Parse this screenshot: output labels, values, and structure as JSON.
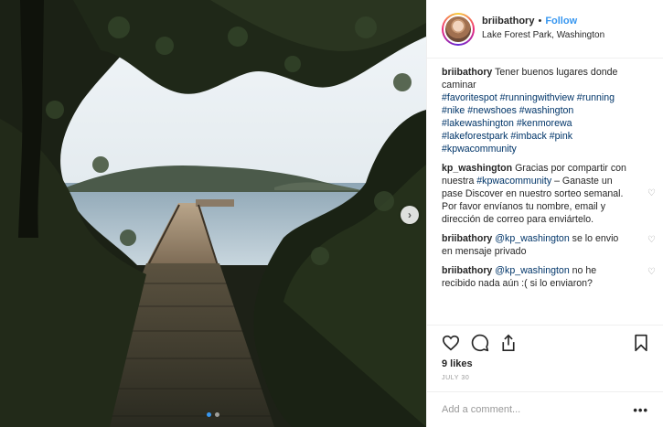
{
  "header": {
    "username": "briibathory",
    "separator": "•",
    "follow_label": "Follow",
    "location": "Lake Forest Park, Washington"
  },
  "caption": {
    "user": "briibathory",
    "text": "Tener buenos lugares donde caminar",
    "hashtags": "#favoritespot #runningwithview #running #nike #newshoes #washington #lakewashington #kenmorewa #lakeforestpark #imback #pink #kpwacommunity"
  },
  "comments": [
    {
      "user": "kp_washington",
      "text_before": "Gracias por compartir con nuestra ",
      "tag": "#kpwacommunity",
      "text_after": " – Ganaste un pase Discover en nuestro sorteo semanal. Por favor envíanos tu nombre, email y dirección de correo para enviártelo."
    },
    {
      "user": "briibathory",
      "mention": "@kp_washington",
      "text": " se lo envio en mensaje privado"
    },
    {
      "user": "briibathory",
      "mention": "@kp_washington",
      "text": " no he recibido nada aún :( si lo enviaron?"
    }
  ],
  "icons": {
    "like": "heart-icon",
    "comment": "comment-icon",
    "share": "share-icon",
    "save": "bookmark-icon",
    "next": "chevron-right-icon",
    "comment_like": "heart-icon",
    "more": "more-options-icon"
  },
  "likes": "9 likes",
  "date": "JULY 30",
  "add_comment": {
    "placeholder": "Add a comment...",
    "more_label": "•••"
  },
  "carousel": {
    "slides": 2,
    "active": 1,
    "next_label": "›"
  },
  "colors": {
    "link": "#003569",
    "follow": "#3897f0",
    "muted": "#999999",
    "text": "#262626"
  }
}
